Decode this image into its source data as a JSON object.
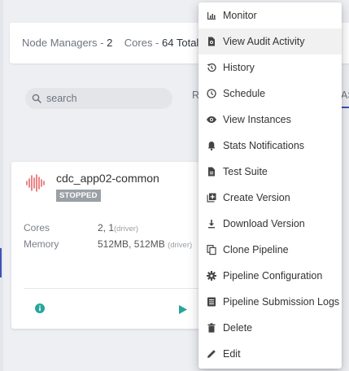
{
  "summary": {
    "node_managers_label": "Node Managers -",
    "node_managers_value": "2",
    "cores_label": "Cores -",
    "cores_value": "64 Total,"
  },
  "search": {
    "placeholder": "search",
    "icon": "search-icon"
  },
  "toolbar": {
    "left_fragment": "R",
    "right_fragment": "AS"
  },
  "pipeline": {
    "name": "cdc_app02-common",
    "status": "STOPPED",
    "icon": "sound-wave-icon",
    "cores_label": "Cores",
    "cores_value": "2, 1",
    "cores_note": "(driver)",
    "memory_label": "Memory",
    "memory_value": "512MB, 512MB",
    "memory_note": "(driver)",
    "accent_color": "#e05151",
    "action_color": "#26a69a"
  },
  "menu": {
    "items": [
      {
        "label": "Monitor",
        "icon": "bar-chart-icon"
      },
      {
        "label": "View Audit Activity",
        "icon": "audit-doc-icon"
      },
      {
        "label": "History",
        "icon": "history-icon"
      },
      {
        "label": "Schedule",
        "icon": "clock-icon"
      },
      {
        "label": "View Instances",
        "icon": "eye-icon"
      },
      {
        "label": "Stats Notifications",
        "icon": "bell-icon"
      },
      {
        "label": "Test Suite",
        "icon": "test-file-icon"
      },
      {
        "label": "Create Version",
        "icon": "add-version-icon"
      },
      {
        "label": "Download Version",
        "icon": "download-icon"
      },
      {
        "label": "Clone Pipeline",
        "icon": "clone-icon"
      },
      {
        "label": "Pipeline Configuration",
        "icon": "settings-icon"
      },
      {
        "label": "Pipeline Submission Logs",
        "icon": "logs-icon"
      },
      {
        "label": "Delete",
        "icon": "trash-icon"
      },
      {
        "label": "Edit",
        "icon": "pencil-icon"
      }
    ]
  }
}
